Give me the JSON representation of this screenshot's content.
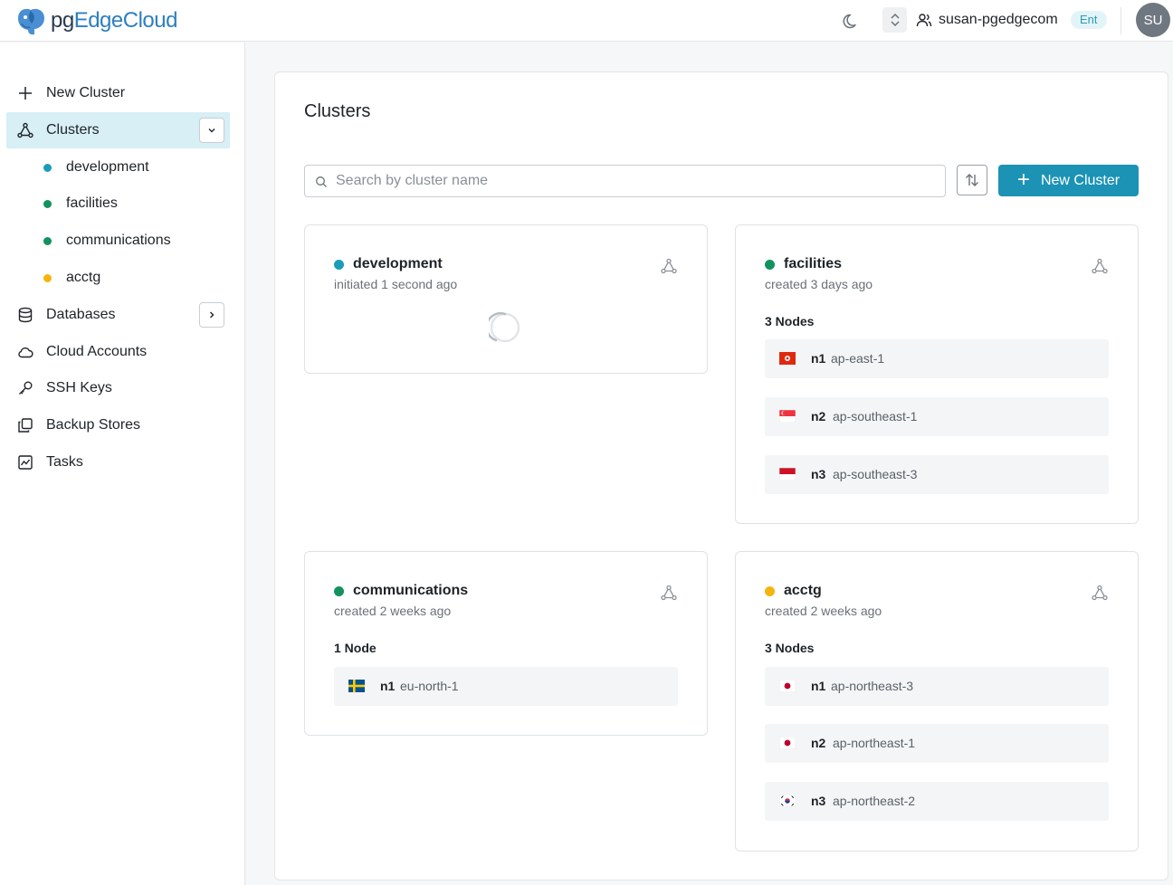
{
  "app": {
    "logo_pre": "pg",
    "logo_mid": "Edge",
    "logo_post": "Cloud"
  },
  "header": {
    "username": "susan-pgedgecom",
    "badge": "Ent",
    "avatar_initials": "SU"
  },
  "sidebar": {
    "items": [
      {
        "label": "New Cluster",
        "icon": "plus-icon"
      },
      {
        "label": "Clusters",
        "icon": "network-icon"
      },
      {
        "label": "Databases",
        "icon": "database-icon"
      },
      {
        "label": "Cloud Accounts",
        "icon": "cloud-icon"
      },
      {
        "label": "SSH Keys",
        "icon": "key-icon"
      },
      {
        "label": "Backup Stores",
        "icon": "copy-icon"
      },
      {
        "label": "Tasks",
        "icon": "chart-icon"
      }
    ],
    "clusters": [
      {
        "label": "development",
        "color": "#1a9db8"
      },
      {
        "label": "facilities",
        "color": "#13925f"
      },
      {
        "label": "communications",
        "color": "#13925f"
      },
      {
        "label": "acctg",
        "color": "#f5b50f"
      }
    ]
  },
  "main": {
    "title": "Clusters",
    "search_placeholder": "Search by cluster name",
    "new_button": "New Cluster",
    "cards": [
      {
        "name": "development",
        "color": "#1a9db8",
        "subtitle": "initiated 1 second ago",
        "node_count": "",
        "nodes": []
      },
      {
        "name": "facilities",
        "color": "#13925f",
        "subtitle": "created 3 days ago",
        "node_count": "3 Nodes",
        "nodes": [
          {
            "id": "n1",
            "region": "ap-east-1",
            "flag": "hk-flag-icon"
          },
          {
            "id": "n2",
            "region": "ap-southeast-1",
            "flag": "sg-flag-icon"
          },
          {
            "id": "n3",
            "region": "ap-southeast-3",
            "flag": "id-flag-icon"
          }
        ]
      },
      {
        "name": "communications",
        "color": "#13925f",
        "subtitle": "created 2 weeks ago",
        "node_count": "1 Node",
        "nodes": [
          {
            "id": "n1",
            "region": "eu-north-1",
            "flag": "se-flag-icon"
          }
        ]
      },
      {
        "name": "acctg",
        "color": "#f5b50f",
        "subtitle": "created 2 weeks ago",
        "node_count": "3 Nodes",
        "nodes": [
          {
            "id": "n1",
            "region": "ap-northeast-3",
            "flag": "jp-flag-icon"
          },
          {
            "id": "n2",
            "region": "ap-northeast-1",
            "flag": "jp-flag-icon"
          },
          {
            "id": "n3",
            "region": "ap-northeast-2",
            "flag": "kr-flag-icon"
          }
        ]
      }
    ]
  }
}
